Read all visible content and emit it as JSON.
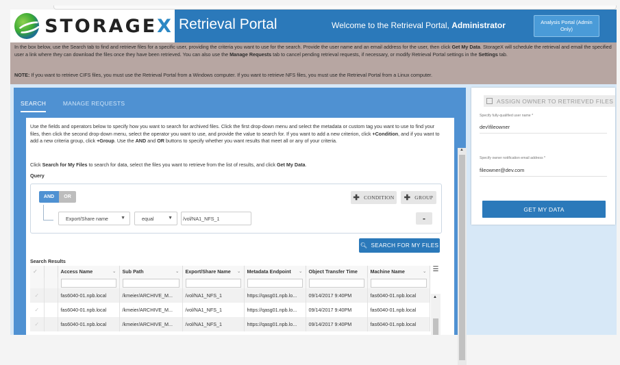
{
  "header": {
    "logo_text_main": "STORAGE",
    "logo_text_accent": "X",
    "portal_title": "Retrieval Portal",
    "welcome_prefix": "Welcome to the Retrieval Portal, ",
    "welcome_user": "Administrator",
    "admin_button_label": "Analysis Portal (Admin Only)"
  },
  "info": {
    "line_pre": "In the box below, use the Search tab to find and retrieve files for a specific user, providing the criteria you want to use for the search. Provide the user name and an email address for the user, then click ",
    "line_bold1": "Get My Data",
    "line_mid": ". StorageX will schedule the retrieval and email the specified user a link where they can download the files once they have been retrieved. You can also use the ",
    "line_bold2": "Manage Requests",
    "line_mid2": " tab to cancel pending retrieval requests, if necessary, or modify Retrieval Portal settings in the ",
    "line_bold3": "Settings",
    "line_post": " tab.",
    "note_label": "NOTE:",
    "note_text": " If you want to retrieve CIFS files, you must use the Retrieval Portal from a Windows computer. If you want to retrieve NFS files, you must use the Retrieval Portal from a Linux computer."
  },
  "tabs": [
    "SEARCH",
    "MANAGE REQUESTS"
  ],
  "instructions": {
    "p1_a": "Use the fields and operators below to specify how you want to search for archived files. Click the first drop-down menu and select the metadata or custom tag you want to use to find your files, then click the second drop-down menu, select the operator you want to use, and provide the value to search for. If you want to add a new criterion, click ",
    "p1_b": "+Condition",
    "p1_c": ", and if you want to add a new criteria group, click ",
    "p1_d": "+Group",
    "p1_e": ". Use the ",
    "p1_f": "AND",
    "p1_g": " and ",
    "p1_h": "OR",
    "p1_i": " buttons to specify whether you want results that meet all or any of your criteria.",
    "p2_a": "Click ",
    "p2_b": "Search for My Files",
    "p2_c": " to search for data, select the files you want to retrieve from the list of results, and click ",
    "p2_d": "Get My Data",
    "p2_e": "."
  },
  "query": {
    "label": "Query",
    "and_label": "AND",
    "or_label": "OR",
    "condition_label": "CONDITION",
    "group_label": "GROUP",
    "field_value": "Export/Share name",
    "operator_value": "equal",
    "search_value": "/vol/NA1_NFS_1",
    "remove_label": "-"
  },
  "search_button": "SEARCH FOR MY FILES",
  "results": {
    "label": "Search Results",
    "columns": [
      "Access Name",
      "Sub Path",
      "Export/Share Name",
      "Metadata Endpoint",
      "Object Transfer Time",
      "Machine Name"
    ],
    "rows": [
      [
        "fas6040-01.npb.local",
        "/kmeier/ARCHIVE_M...",
        "/vol/NA1_NFS_1",
        "https://qasg01.npb.lo...",
        "09/14/2017 9:40PM",
        "fas6040-01.npb.local"
      ],
      [
        "fas6040-01.npb.local",
        "/kmeier/ARCHIVE_M...",
        "/vol/NA1_NFS_1",
        "https://qasg01.npb.lo...",
        "09/14/2017 9:40PM",
        "fas6040-01.npb.local"
      ],
      [
        "fas6040-01.npb.local",
        "/kmeier/ARCHIVE_M...",
        "/vol/NA1_NFS_1",
        "https://qasg01.npb.lo...",
        "09/14/2017 9:40PM",
        "fas6040-01.npb.local"
      ]
    ]
  },
  "owner": {
    "assign_label": "ASSIGN OWNER TO RETRIEVED FILES",
    "username_label": "Specify fully-qualified user name *",
    "username_value": "dev\\fileowner",
    "email_label": "Specify owner notification email address *",
    "email_value": "fileowner@dev.com",
    "get_button": "GET MY DATA"
  },
  "colors": {
    "brand_blue": "#2b79ba",
    "panel_blue": "#4f91d2",
    "info_bg": "#b7a6a2"
  }
}
